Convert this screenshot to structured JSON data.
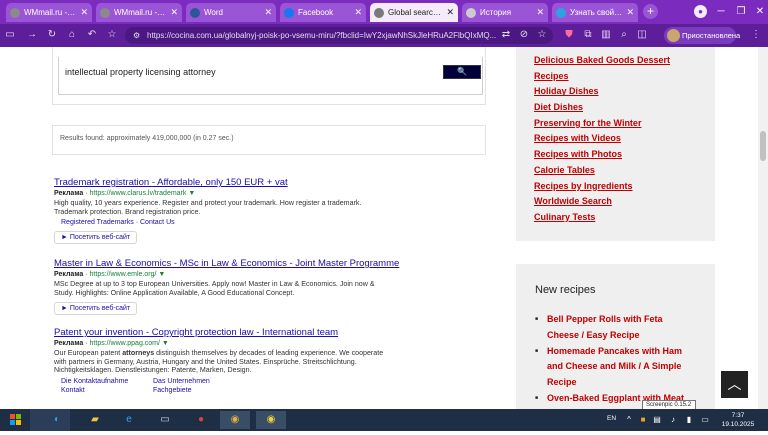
{
  "tabs": [
    {
      "label": "WMmail.ru - серф",
      "favicon_color": "#8a8a8a",
      "active": false
    },
    {
      "label": "WMmail.ru - emai",
      "favicon_color": "#8a8a8a",
      "active": false
    },
    {
      "label": "Word",
      "favicon_color": "#2b579a",
      "active": false
    },
    {
      "label": "Facebook",
      "favicon_color": "#1877f2",
      "active": false
    },
    {
      "label": "Global search wo",
      "favicon_color": "#7a7a7a",
      "active": true
    },
    {
      "label": "История",
      "favicon_color": "#cccccc",
      "active": false
    },
    {
      "label": "Узнать свой IP а",
      "favicon_color": "#2aa4e0",
      "active": false
    }
  ],
  "toolbar": {
    "url": "https://cocina.com.ua/globalnyj-poisk-po-vsemu-miru/?fbclid=IwY2xjawNhSkJleHRuA2FlbQIxMQ...",
    "paused_label": "Приостановлена"
  },
  "search": {
    "query": "intellectual property licensing attorney",
    "clear_glyph": "✕",
    "button_glyph": "🔍"
  },
  "results": {
    "count_text": "Results found: approximately 419,000,000 (in 0.27 sec.)"
  },
  "ads": [
    {
      "title": "Trademark registration - Affordable, only 150 EUR + vat",
      "label": "Реклама",
      "url": "https://www.clarus.lv/trademark ▼",
      "desc": "High quality, 10 years experience. Register and protect your trademark. How register a trademark. Trademark protection. Brand registration price.",
      "links": [
        "Registered Trademarks",
        "Contact Us"
      ],
      "visit": "► Посетить веб-сайт"
    },
    {
      "title": "Master in Law & Economics - MSc in Law & Economics - Joint Master Programme",
      "label": "Реклама",
      "url": "https://www.emle.org/ ▼",
      "desc": "MSc Degree at up to 3 top European Universities. Apply now! Master in Law & Economics. Join now & Study. Highlights: Online Application Available, A Good Educational Concept.",
      "visit": "► Посетить веб-сайт"
    },
    {
      "title": "Patent your invention - Copyright protection law - International team",
      "label": "Реклама",
      "url": "https://www.ppag.com/ ▼",
      "desc_before": "Our European patent ",
      "desc_bold": "attorneys",
      "desc_after": " distinguish themselves by decades of leading experience. We cooperate with partners in Germany, Austria, Hungary and the United States. Einsprüche. Streitschlichtung. Nichtigkeitsklagen. Dienstleistungen: Patente, Marken, Design.",
      "links": [
        "Die Kontaktaufnahme",
        "Das Unternehmen",
        "Kontakt",
        "Fachgebiete"
      ]
    }
  ],
  "sidebar": {
    "categories": [
      "Delicious Baked Goods Dessert",
      "Recipes",
      "Holiday Dishes",
      "Diet Dishes",
      "Preserving for the Winter",
      "Recipes with Videos",
      "Recipes with Photos",
      "Calorie Tables",
      "Recipes by Ingredients",
      "Worldwide Search",
      "Culinary Tests"
    ],
    "new_recipes_title": "New recipes",
    "new_recipes": [
      "Bell Pepper Rolls with Feta Cheese / Easy Recipe",
      "Homemade Pancakes with Ham and Cheese and Milk / A Simple Recipe",
      "Oven-Baked Eggplant with Meat"
    ]
  },
  "tooltip": "Screenpic 0.15.2",
  "taskbar": {
    "lang": "EN",
    "time": "7:37",
    "date": "19.10.2025"
  }
}
